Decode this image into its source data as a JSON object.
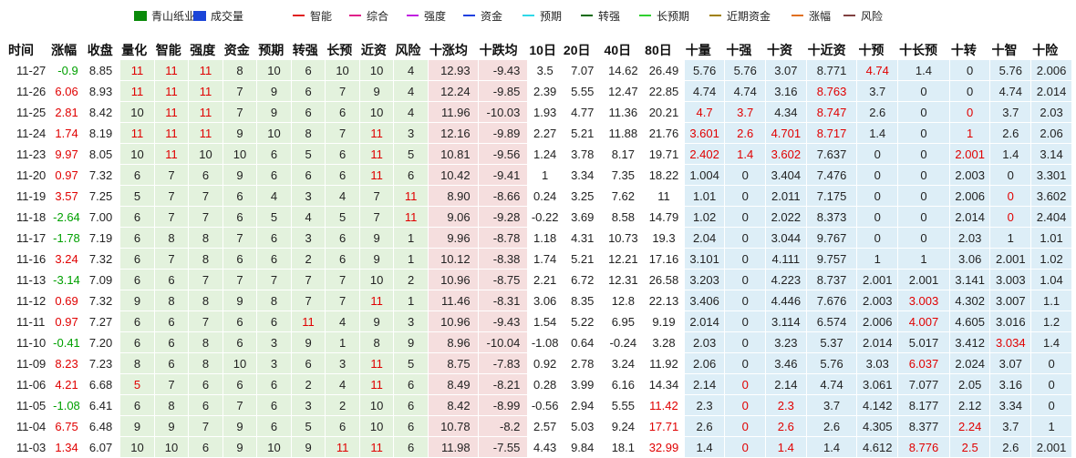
{
  "legend": [
    {
      "label": "青山纸业",
      "color": "#0a8a0a",
      "shape": "square"
    },
    {
      "label": "成交量",
      "color": "#1a44d8",
      "shape": "square"
    },
    {
      "label": "智能",
      "color": "#e02020",
      "shape": "line"
    },
    {
      "label": "综合",
      "color": "#e0208a",
      "shape": "line"
    },
    {
      "label": "强度",
      "color": "#c020e0",
      "shape": "line"
    },
    {
      "label": "资金",
      "color": "#2040e0",
      "shape": "line"
    },
    {
      "label": "预期",
      "color": "#30d8e8",
      "shape": "line"
    },
    {
      "label": "转强",
      "color": "#0a6a0a",
      "shape": "line"
    },
    {
      "label": "长预期",
      "color": "#30d030",
      "shape": "line"
    },
    {
      "label": "近期资金",
      "color": "#a08000",
      "shape": "line"
    },
    {
      "label": "涨幅",
      "color": "#e07020",
      "shape": "line"
    },
    {
      "label": "风险",
      "color": "#804040",
      "shape": "line"
    }
  ],
  "chart_data": {
    "type": "table",
    "columns": [
      "时间",
      "涨幅",
      "收盘",
      "量化",
      "智能",
      "强度",
      "资金",
      "预期",
      "转强",
      "长预",
      "近资",
      "风险",
      "十涨均",
      "十跌均",
      "10日",
      "20日",
      "40日",
      "80日",
      "十量",
      "十强",
      "十资",
      "十近资",
      "十预",
      "十长预",
      "十转",
      "十智",
      "十险"
    ],
    "rows": [
      [
        "11-27",
        "-0.9",
        "8.85",
        "11",
        "11",
        "11",
        "8",
        "10",
        "6",
        "10",
        "10",
        "4",
        "12.93",
        "-9.43",
        "3.5",
        "7.07",
        "14.62",
        "26.49",
        "5.76",
        "5.76",
        "3.07",
        "8.771",
        "4.74",
        "1.4",
        "0",
        "5.76",
        "2.006"
      ],
      [
        "11-26",
        "6.06",
        "8.93",
        "11",
        "11",
        "11",
        "7",
        "9",
        "6",
        "7",
        "9",
        "4",
        "12.24",
        "-9.85",
        "2.39",
        "5.55",
        "12.47",
        "22.85",
        "4.74",
        "4.74",
        "3.16",
        "8.763",
        "3.7",
        "0",
        "0",
        "4.74",
        "2.014"
      ],
      [
        "11-25",
        "2.81",
        "8.42",
        "10",
        "11",
        "11",
        "7",
        "9",
        "6",
        "6",
        "10",
        "4",
        "11.96",
        "-10.03",
        "1.93",
        "4.77",
        "11.36",
        "20.21",
        "4.7",
        "3.7",
        "4.34",
        "8.747",
        "2.6",
        "0",
        "0",
        "3.7",
        "2.03"
      ],
      [
        "11-24",
        "1.74",
        "8.19",
        "11",
        "11",
        "11",
        "9",
        "10",
        "8",
        "7",
        "11",
        "3",
        "12.16",
        "-9.89",
        "2.27",
        "5.21",
        "11.88",
        "21.76",
        "3.601",
        "2.6",
        "4.701",
        "8.717",
        "1.4",
        "0",
        "1",
        "2.6",
        "2.06"
      ],
      [
        "11-23",
        "9.97",
        "8.05",
        "10",
        "11",
        "10",
        "10",
        "6",
        "5",
        "6",
        "11",
        "5",
        "10.81",
        "-9.56",
        "1.24",
        "3.78",
        "8.17",
        "19.71",
        "2.402",
        "1.4",
        "3.602",
        "7.637",
        "0",
        "0",
        "2.001",
        "1.4",
        "3.14"
      ],
      [
        "11-20",
        "0.97",
        "7.32",
        "6",
        "7",
        "6",
        "9",
        "6",
        "6",
        "6",
        "11",
        "6",
        "10.42",
        "-9.41",
        "1",
        "3.34",
        "7.35",
        "18.22",
        "1.004",
        "0",
        "3.404",
        "7.476",
        "0",
        "0",
        "2.003",
        "0",
        "3.301"
      ],
      [
        "11-19",
        "3.57",
        "7.25",
        "5",
        "7",
        "7",
        "6",
        "4",
        "3",
        "4",
        "7",
        "11",
        "8.90",
        "-8.66",
        "0.24",
        "3.25",
        "7.62",
        "11",
        "1.01",
        "0",
        "2.011",
        "7.175",
        "0",
        "0",
        "2.006",
        "0",
        "3.602"
      ],
      [
        "11-18",
        "-2.64",
        "7.00",
        "6",
        "7",
        "7",
        "6",
        "5",
        "4",
        "5",
        "7",
        "11",
        "9.06",
        "-9.28",
        "-0.22",
        "3.69",
        "8.58",
        "14.79",
        "1.02",
        "0",
        "2.022",
        "8.373",
        "0",
        "0",
        "2.014",
        "0",
        "2.404"
      ],
      [
        "11-17",
        "-1.78",
        "7.19",
        "6",
        "8",
        "8",
        "7",
        "6",
        "3",
        "6",
        "9",
        "1",
        "9.96",
        "-8.78",
        "1.18",
        "4.31",
        "10.73",
        "19.3",
        "2.04",
        "0",
        "3.044",
        "9.767",
        "0",
        "0",
        "2.03",
        "1",
        "1.01"
      ],
      [
        "11-16",
        "3.24",
        "7.32",
        "6",
        "7",
        "8",
        "6",
        "6",
        "2",
        "6",
        "9",
        "1",
        "10.12",
        "-8.38",
        "1.74",
        "5.21",
        "12.21",
        "17.16",
        "3.101",
        "0",
        "4.111",
        "9.757",
        "1",
        "1",
        "3.06",
        "2.001",
        "1.02"
      ],
      [
        "11-13",
        "-3.14",
        "7.09",
        "6",
        "6",
        "7",
        "7",
        "7",
        "7",
        "7",
        "10",
        "2",
        "10.96",
        "-8.75",
        "2.21",
        "6.72",
        "12.31",
        "26.58",
        "3.203",
        "0",
        "4.223",
        "8.737",
        "2.001",
        "2.001",
        "3.141",
        "3.003",
        "1.04"
      ],
      [
        "11-12",
        "0.69",
        "7.32",
        "9",
        "8",
        "8",
        "9",
        "8",
        "7",
        "7",
        "11",
        "1",
        "11.46",
        "-8.31",
        "3.06",
        "8.35",
        "12.8",
        "22.13",
        "3.406",
        "0",
        "4.446",
        "7.676",
        "2.003",
        "3.003",
        "4.302",
        "3.007",
        "1.1"
      ],
      [
        "11-11",
        "0.97",
        "7.27",
        "6",
        "6",
        "7",
        "6",
        "6",
        "11",
        "4",
        "9",
        "3",
        "10.96",
        "-9.43",
        "1.54",
        "5.22",
        "6.95",
        "9.19",
        "2.014",
        "0",
        "3.114",
        "6.574",
        "2.006",
        "4.007",
        "4.605",
        "3.016",
        "1.2"
      ],
      [
        "11-10",
        "-0.41",
        "7.20",
        "6",
        "6",
        "8",
        "6",
        "3",
        "9",
        "1",
        "8",
        "9",
        "8.96",
        "-10.04",
        "-1.08",
        "0.64",
        "-0.24",
        "3.28",
        "2.03",
        "0",
        "3.23",
        "5.37",
        "2.014",
        "5.017",
        "3.412",
        "3.034",
        "1.4"
      ],
      [
        "11-09",
        "8.23",
        "7.23",
        "8",
        "6",
        "8",
        "10",
        "3",
        "6",
        "3",
        "11",
        "5",
        "8.75",
        "-7.83",
        "0.92",
        "2.78",
        "3.24",
        "11.92",
        "2.06",
        "0",
        "3.46",
        "5.76",
        "3.03",
        "6.037",
        "2.024",
        "3.07",
        "0"
      ],
      [
        "11-06",
        "4.21",
        "6.68",
        "5",
        "7",
        "6",
        "6",
        "6",
        "2",
        "4",
        "11",
        "6",
        "8.49",
        "-8.21",
        "0.28",
        "3.99",
        "6.16",
        "14.34",
        "2.14",
        "0",
        "2.14",
        "4.74",
        "3.061",
        "7.077",
        "2.05",
        "3.16",
        "0"
      ],
      [
        "11-05",
        "-1.08",
        "6.41",
        "6",
        "8",
        "6",
        "7",
        "6",
        "3",
        "2",
        "10",
        "6",
        "8.42",
        "-8.99",
        "-0.56",
        "2.94",
        "5.55",
        "11.42",
        "2.3",
        "0",
        "2.3",
        "3.7",
        "4.142",
        "8.177",
        "2.12",
        "3.34",
        "0"
      ],
      [
        "11-04",
        "6.75",
        "6.48",
        "9",
        "9",
        "7",
        "9",
        "6",
        "5",
        "6",
        "10",
        "6",
        "10.78",
        "-8.2",
        "2.57",
        "5.03",
        "9.24",
        "17.71",
        "2.6",
        "0",
        "2.6",
        "2.6",
        "4.305",
        "8.377",
        "2.24",
        "3.7",
        "1"
      ],
      [
        "11-03",
        "1.34",
        "6.07",
        "10",
        "10",
        "6",
        "9",
        "10",
        "9",
        "11",
        "11",
        "6",
        "11.98",
        "-7.55",
        "4.43",
        "9.84",
        "18.1",
        "32.99",
        "1.4",
        "0",
        "1.4",
        "1.4",
        "4.612",
        "8.776",
        "2.5",
        "2.6",
        "2.001"
      ]
    ],
    "red_cells": [
      [
        0,
        22
      ],
      [
        1,
        21
      ],
      [
        2,
        18
      ],
      [
        2,
        19
      ],
      [
        2,
        21
      ],
      [
        2,
        24
      ],
      [
        3,
        18
      ],
      [
        3,
        19
      ],
      [
        3,
        20
      ],
      [
        3,
        21
      ],
      [
        3,
        24
      ],
      [
        4,
        18
      ],
      [
        4,
        19
      ],
      [
        4,
        20
      ],
      [
        4,
        24
      ],
      [
        6,
        25
      ],
      [
        7,
        25
      ],
      [
        11,
        23
      ],
      [
        12,
        23
      ],
      [
        13,
        25
      ],
      [
        14,
        23
      ],
      [
        15,
        3
      ],
      [
        15,
        19
      ],
      [
        16,
        17
      ],
      [
        16,
        19
      ],
      [
        16,
        20
      ],
      [
        17,
        17
      ],
      [
        17,
        19
      ],
      [
        17,
        20
      ],
      [
        17,
        24
      ],
      [
        18,
        17
      ],
      [
        18,
        19
      ],
      [
        18,
        20
      ],
      [
        18,
        23
      ],
      [
        18,
        24
      ]
    ],
    "colors": {
      "up": "#e00000",
      "down": "#00a000",
      "neutral": "#222222",
      "zone_green": "#e3f2dd",
      "zone_pink": "#f5dede",
      "zone_blue": "#ddeef7"
    }
  }
}
